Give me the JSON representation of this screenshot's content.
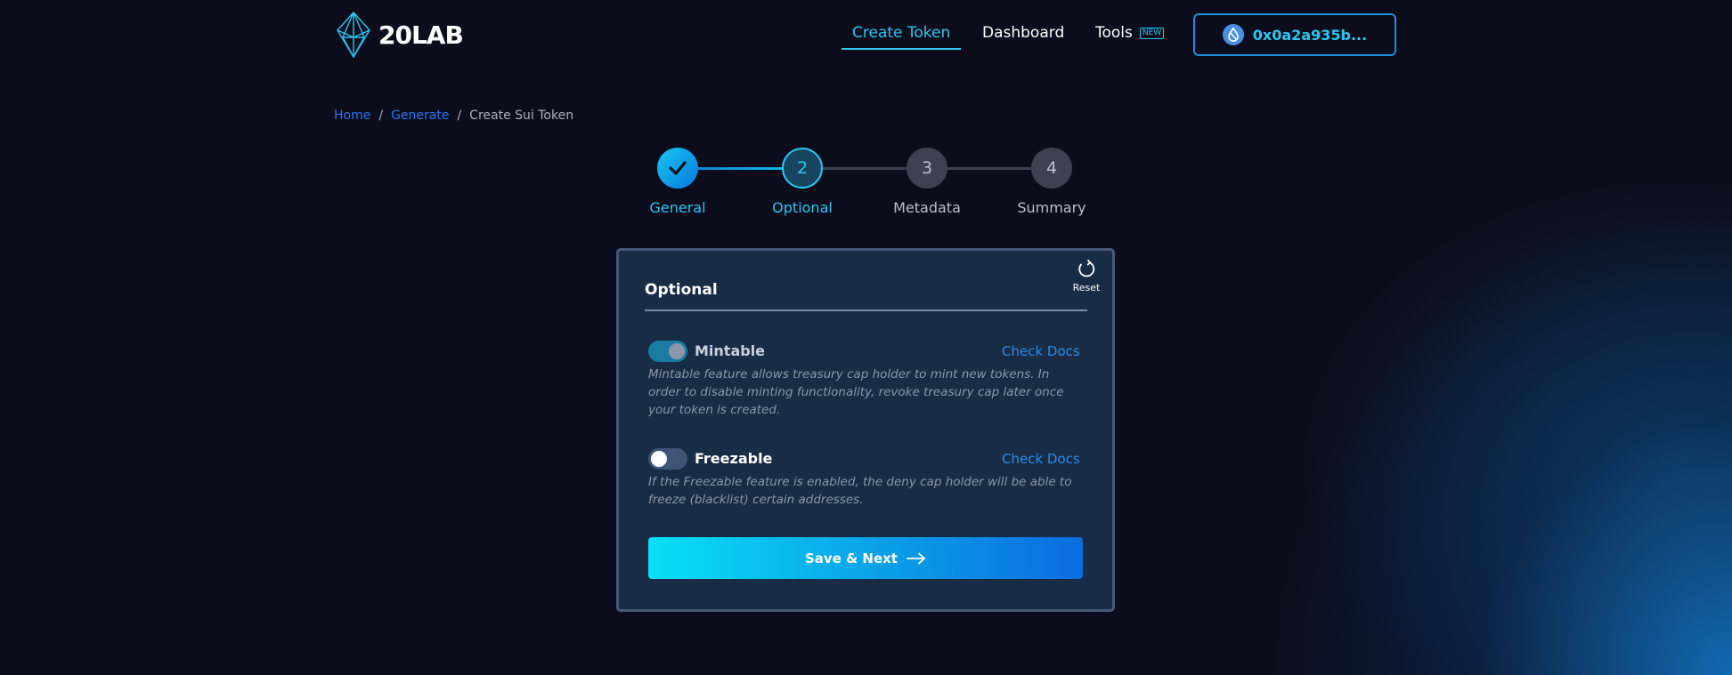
{
  "header": {
    "logo_text": "20LAB",
    "nav": [
      {
        "label": "Create Token",
        "active": true
      },
      {
        "label": "Dashboard",
        "active": false
      },
      {
        "label": "Tools",
        "active": false,
        "badge": "NEW"
      }
    ],
    "wallet": {
      "address": "0x0a2a935b...",
      "icon": "sui-drop-icon"
    }
  },
  "breadcrumb": {
    "items": [
      "Home",
      "Generate",
      "Create Sui Token"
    ],
    "separator": "/"
  },
  "stepper": {
    "steps": [
      {
        "label": "General",
        "number": "1",
        "state": "completed"
      },
      {
        "label": "Optional",
        "number": "2",
        "state": "active"
      },
      {
        "label": "Metadata",
        "number": "3",
        "state": "upcoming"
      },
      {
        "label": "Summary",
        "number": "4",
        "state": "upcoming"
      }
    ]
  },
  "card": {
    "title": "Optional",
    "reset_label": "Reset",
    "options": [
      {
        "label": "Mintable",
        "enabled": true,
        "docs_label": "Check Docs",
        "description": "Mintable feature allows treasury cap holder to mint new tokens. In order to disable minting functionality, revoke treasury cap later once your token is created."
      },
      {
        "label": "Freezable",
        "enabled": false,
        "docs_label": "Check Docs",
        "description": "If the Freezable feature is enabled, the deny cap holder will be able to freeze (blacklist) certain addresses."
      }
    ],
    "submit_label": "Save & Next"
  },
  "colors": {
    "accent": "#2dc6f0",
    "link": "#2a74f0",
    "background": "#0b0d1c",
    "card": "#182c45"
  }
}
